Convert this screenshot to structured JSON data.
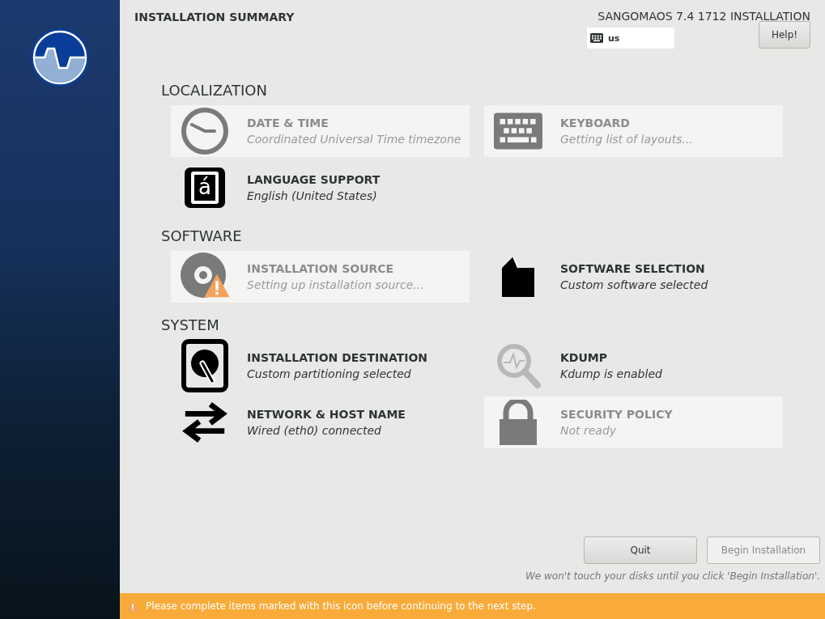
{
  "header": {
    "title": "INSTALLATION SUMMARY",
    "product": "SANGOMAOS 7.4 1712 INSTALLATION",
    "keyboard_layout": "us",
    "help_button": "Help!"
  },
  "sections": [
    {
      "title": "LOCALIZATION",
      "spokes": [
        {
          "kind": "clock",
          "title": "DATE & TIME",
          "status": "Coordinated Universal Time timezone",
          "disabled": true,
          "warning": false
        },
        {
          "kind": "keyboard",
          "title": "KEYBOARD",
          "status": "Getting list of layouts...",
          "disabled": true,
          "warning": false
        },
        {
          "kind": "language",
          "icon_text": "á",
          "title": "LANGUAGE SUPPORT",
          "status": "English (United States)",
          "disabled": false,
          "warning": false
        }
      ]
    },
    {
      "title": "SOFTWARE",
      "spokes": [
        {
          "kind": "disc",
          "title": "INSTALLATION SOURCE",
          "status": "Setting up installation source...",
          "disabled": true,
          "warning": true
        },
        {
          "kind": "package",
          "title": "SOFTWARE SELECTION",
          "status": "Custom software selected",
          "disabled": false,
          "warning": false
        }
      ]
    },
    {
      "title": "SYSTEM",
      "spokes": [
        {
          "kind": "disk",
          "title": "INSTALLATION DESTINATION",
          "status": "Custom partitioning selected",
          "disabled": false,
          "warning": false
        },
        {
          "kind": "search",
          "title": "KDUMP",
          "status": "Kdump is enabled",
          "disabled": false,
          "warning": false
        },
        {
          "kind": "network",
          "title": "NETWORK & HOST NAME",
          "status": "Wired (eth0) connected",
          "disabled": false,
          "warning": false
        },
        {
          "kind": "lock",
          "title": "SECURITY POLICY",
          "status": "Not ready",
          "disabled": true,
          "warning": false
        }
      ]
    }
  ],
  "footer": {
    "buttons": [
      {
        "label": "Quit",
        "disabled": false
      },
      {
        "label": "Begin Installation",
        "disabled": true
      }
    ],
    "note": "We won't touch your disks until you click 'Begin Installation'."
  },
  "warning_bar": {
    "message": "Please complete items marked with this icon before continuing to the next step."
  }
}
